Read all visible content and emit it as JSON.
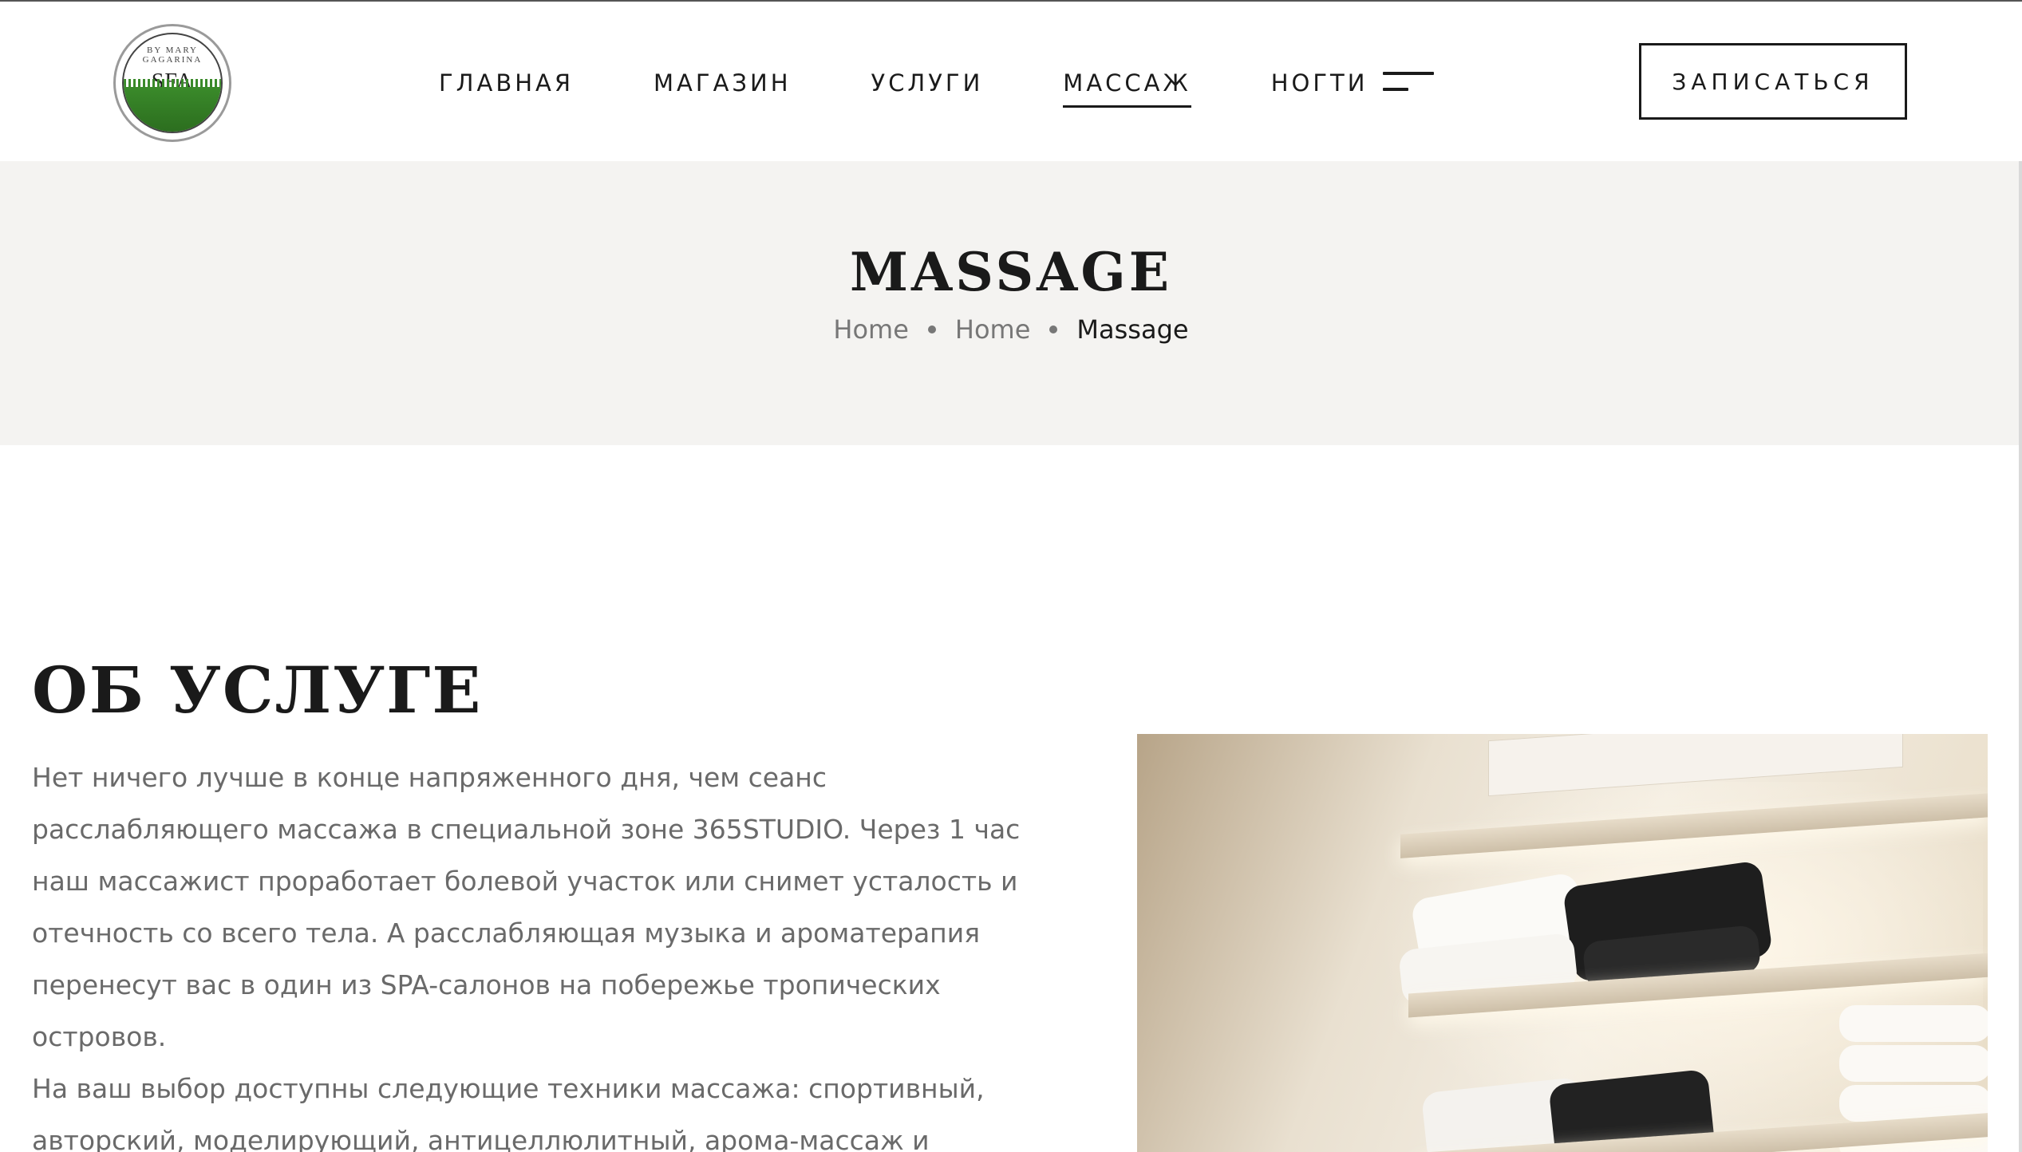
{
  "header": {
    "logo": {
      "text": "SFA",
      "arc_text": "BY MARY GAGARINA"
    },
    "nav": [
      {
        "label": "ГЛАВНАЯ",
        "active": false
      },
      {
        "label": "МАГАЗИН",
        "active": false
      },
      {
        "label": "УСЛУГИ",
        "active": false
      },
      {
        "label": "МАССАЖ",
        "active": true
      },
      {
        "label": "НОГТИ",
        "active": false
      }
    ],
    "menu_icon": "menu-icon",
    "cta_label": "ЗАПИСАТЬСЯ"
  },
  "title_band": {
    "title": "MASSAGE",
    "breadcrumb": [
      "Home",
      "Home",
      "Massage"
    ]
  },
  "content": {
    "section_title": "ОБ УСЛУГЕ",
    "paragraph_1": "Нет ничего лучше в конце напряженного дня, чем сеанс расслабляющего массажа в специальной зоне 365STUDIO. Через 1 час наш массажист проработает болевой участок или снимет усталость и отечность со всего тела. А расслабляющая музыка и ароматерапия перенесут вас в один из SPA-салонов на побережье тропических островов.",
    "paragraph_2": "На ваш выбор доступны следующие техники массажа: спортивный, авторский, моделирующий, антицеллюлитный, арома-массаж и"
  },
  "colors": {
    "band_bg": "#f4f3f1",
    "text_dark": "#1a1a1a",
    "text_muted": "#6a6a6a"
  }
}
